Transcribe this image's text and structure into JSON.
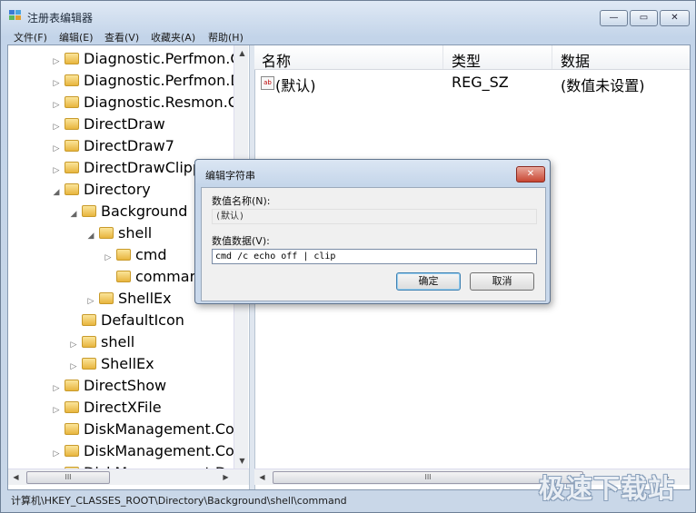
{
  "window": {
    "title": "注册表编辑器",
    "minimize": "—",
    "maximize": "▭",
    "close": "✕"
  },
  "menu": [
    "文件(F)",
    "编辑(E)",
    "查看(V)",
    "收藏夹(A)",
    "帮助(H)"
  ],
  "tree": {
    "items": [
      {
        "label": "Diagnostic.Perfmon.C",
        "indent": 0,
        "expander": "▷"
      },
      {
        "label": "Diagnostic.Perfmon.D",
        "indent": 0,
        "expander": "▷"
      },
      {
        "label": "Diagnostic.Resmon.Co",
        "indent": 0,
        "expander": "▷"
      },
      {
        "label": "DirectDraw",
        "indent": 0,
        "expander": "▷"
      },
      {
        "label": "DirectDraw7",
        "indent": 0,
        "expander": "▷"
      },
      {
        "label": "DirectDrawClipp",
        "indent": 0,
        "expander": "▷"
      },
      {
        "label": "Directory",
        "indent": 0,
        "expander": "◢"
      },
      {
        "label": "Background",
        "indent": 1,
        "expander": "◢"
      },
      {
        "label": "shell",
        "indent": 2,
        "expander": "◢"
      },
      {
        "label": "cmd",
        "indent": 3,
        "expander": "▷"
      },
      {
        "label": "command",
        "indent": 3,
        "expander": ""
      },
      {
        "label": "ShellEx",
        "indent": 2,
        "expander": "▷"
      },
      {
        "label": "DefaultIcon",
        "indent": 1,
        "expander": ""
      },
      {
        "label": "shell",
        "indent": 1,
        "expander": "▷"
      },
      {
        "label": "ShellEx",
        "indent": 1,
        "expander": "▷"
      },
      {
        "label": "DirectShow",
        "indent": 0,
        "expander": "▷"
      },
      {
        "label": "DirectXFile",
        "indent": 0,
        "expander": "▷"
      },
      {
        "label": "DiskManagement.Con",
        "indent": 0,
        "expander": ""
      },
      {
        "label": "DiskManagement.Con",
        "indent": 0,
        "expander": "▷"
      },
      {
        "label": "DiskManagement.Dat",
        "indent": 0,
        "expander": "▷"
      }
    ],
    "selected_index": 10
  },
  "list": {
    "columns": [
      "名称",
      "类型",
      "数据"
    ],
    "rows": [
      {
        "name": "(默认)",
        "type": "REG_SZ",
        "data": "(数值未设置)"
      }
    ]
  },
  "scroll": {
    "up": "▲",
    "down": "▼",
    "left": "◀",
    "right": "▶",
    "grip": "III"
  },
  "status_bar": "计算机\\HKEY_CLASSES_ROOT\\Directory\\Background\\shell\\command",
  "watermark": "极速下载站",
  "dialog": {
    "title": "编辑字符串",
    "close": "✕",
    "value_name_label": "数值名称(N):",
    "value_name": "(默认)",
    "value_data_label": "数值数据(V):",
    "value_data": "cmd /c echo off | clip",
    "ok": "确定",
    "cancel": "取消"
  }
}
